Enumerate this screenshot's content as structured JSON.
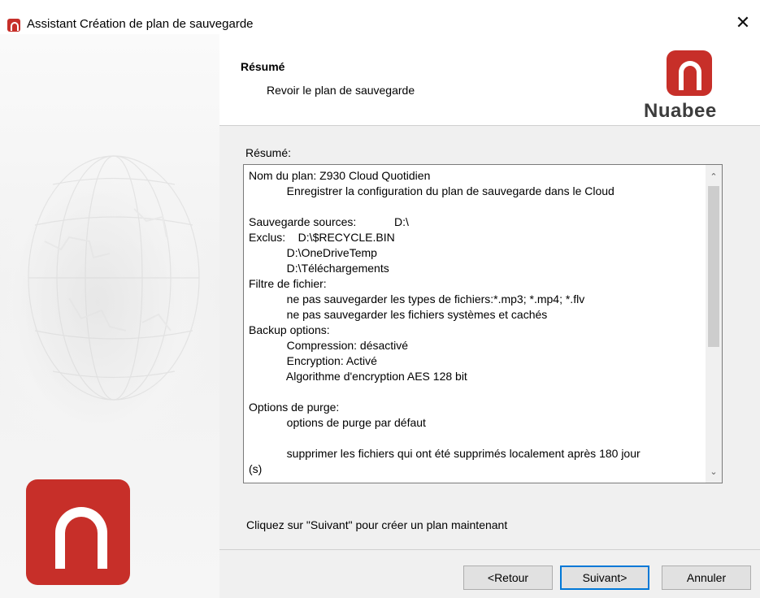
{
  "window": {
    "title": "Assistant Création de plan de sauvegarde",
    "close_glyph": "✕"
  },
  "header": {
    "title": "Résumé",
    "subtitle": "Revoir le plan de sauvegarde",
    "brand": "Nuabee"
  },
  "summary": {
    "label": "Résumé:",
    "text": "Nom du plan: Z930 Cloud Quotidien\n            Enregistrer la configuration du plan de sauvegarde dans le Cloud\n\nSauvegarde sources:            D:\\\nExclus:    D:\\$RECYCLE.BIN\n            D:\\OneDriveTemp\n            D:\\Téléchargements\nFiltre de fichier:\n            ne pas sauvegarder les types de fichiers:*.mp3; *.mp4; *.flv\n            ne pas sauvegarder les fichiers systèmes et cachés\nBackup options:\n            Compression: désactivé\n            Encryption: Activé\n            Algorithme d'encryption AES 128 bit\n\nOptions de purge:\n            options de purge par défaut\n\n            supprimer les fichiers qui ont été supprimés localement après 180 jour\n(s)",
    "scroll_up": "⌃",
    "scroll_down": "⌄"
  },
  "hint": "Cliquez sur \"Suivant\" pour créer un plan maintenant",
  "buttons": {
    "back": "<Retour",
    "next": "Suivant>",
    "cancel": "Annuler"
  },
  "colors": {
    "brand_red": "#c72f29",
    "focus_blue": "#0078d7",
    "panel_bg": "#f0f0f0"
  }
}
